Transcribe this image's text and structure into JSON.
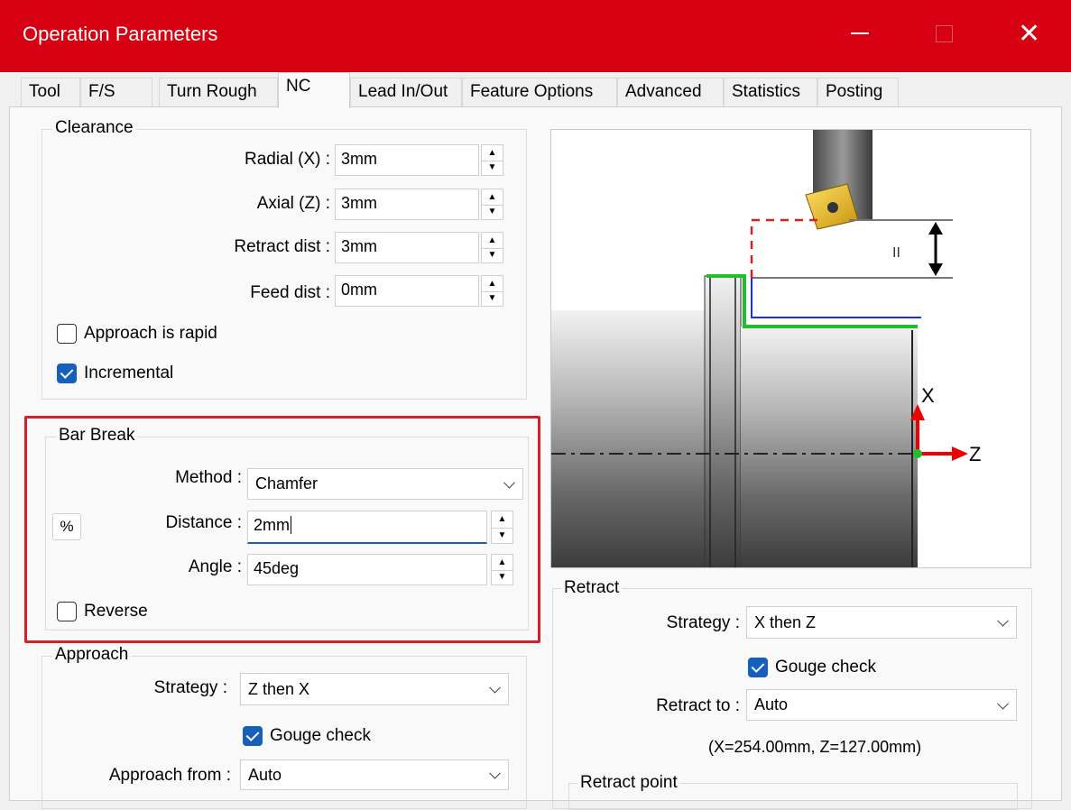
{
  "window": {
    "title": "Operation Parameters"
  },
  "tabs": [
    "Tool",
    "F/S",
    "Turn Rough",
    "NC",
    "Lead In/Out",
    "Feature Options",
    "Advanced",
    "Statistics",
    "Posting"
  ],
  "clearance": {
    "label": "Clearance",
    "radial_label": "Radial (X) :",
    "radial_value": "3mm",
    "axial_label": "Axial (Z) :",
    "axial_value": "3mm",
    "retract_label": "Retract dist :",
    "retract_value": "3mm",
    "feed_label": "Feed dist :",
    "feed_value": "0mm",
    "approach_rapid_label": "Approach is rapid",
    "approach_rapid_checked": false,
    "incremental_label": "Incremental",
    "incremental_checked": true
  },
  "bar_break": {
    "label": "Bar Break",
    "method_label": "Method :",
    "method_value": "Chamfer",
    "percent_button": "%",
    "distance_label": "Distance :",
    "distance_value": "2mm",
    "angle_label": "Angle :",
    "angle_value": "45deg",
    "reverse_label": "Reverse",
    "reverse_checked": false
  },
  "approach": {
    "label": "Approach",
    "strategy_label": "Strategy :",
    "strategy_value": "Z then X",
    "gouge_label": "Gouge check",
    "gouge_checked": true,
    "from_label": "Approach from :",
    "from_value": "Auto"
  },
  "retract": {
    "label": "Retract",
    "strategy_label": "Strategy :",
    "strategy_value": "X then Z",
    "gouge_label": "Gouge check",
    "gouge_checked": true,
    "to_label": "Retract to :",
    "to_value": "Auto",
    "coords": "(X=254.00mm, Z=127.00mm)",
    "point_label": "Retract point"
  },
  "diagram": {
    "axis_x": "X",
    "axis_z": "Z",
    "dim_mark": "II"
  },
  "colors": {
    "titlebar": "#d70012",
    "highlight_box": "#d42027",
    "checkbox_checked": "#1560bd",
    "toolpath_green": "#1fbf2a",
    "toolpath_blue": "#1a2bff"
  }
}
